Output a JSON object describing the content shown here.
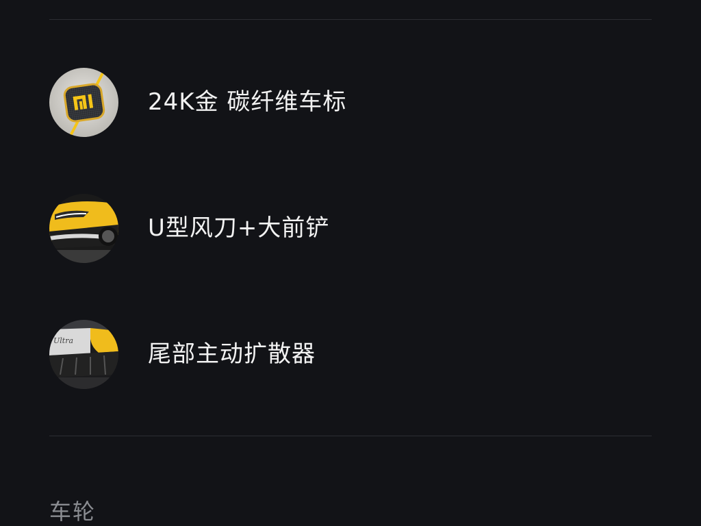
{
  "features": [
    {
      "label": "24K金 碳纤维车标",
      "thumb": "xiaomi-logo-badge"
    },
    {
      "label": "U型风刀+大前铲",
      "thumb": "yellow-car-front"
    },
    {
      "label": "尾部主动扩散器",
      "thumb": "rear-diffuser"
    }
  ],
  "section": {
    "title": "车轮"
  },
  "colors": {
    "background": "#121317",
    "divider": "#2c2e33",
    "text": "#f2f2f2",
    "section_text": "#8a8c91",
    "accent_yellow": "#f5c518"
  }
}
